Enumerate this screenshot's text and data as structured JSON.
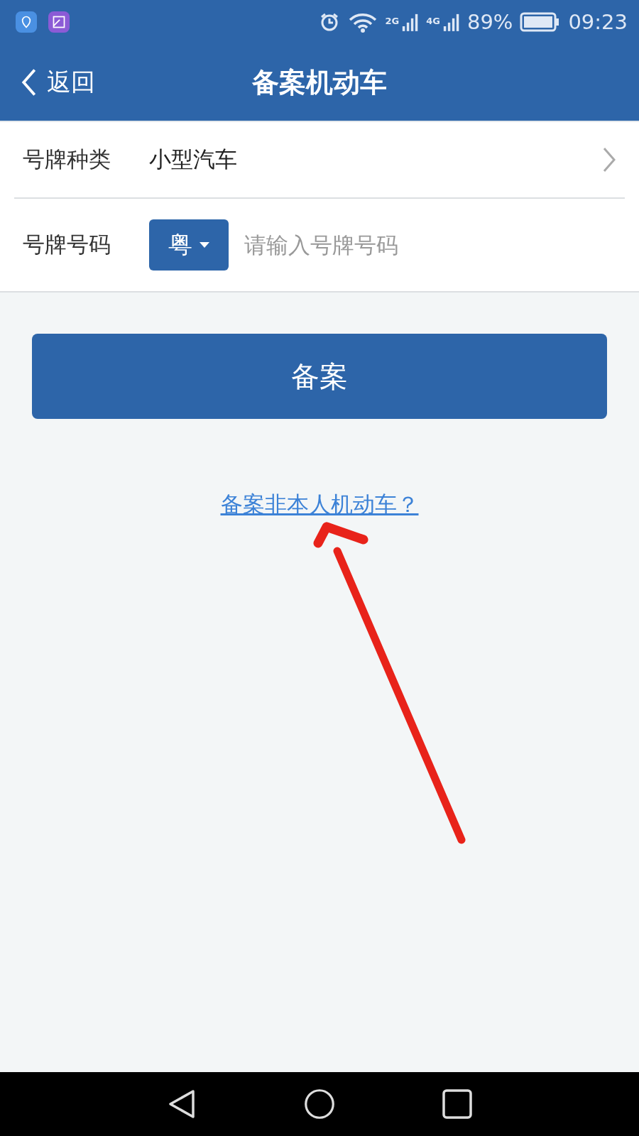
{
  "status_bar": {
    "network_1": "2G",
    "network_2": "4G",
    "battery": "89%",
    "time": "09:23"
  },
  "nav": {
    "back": "返回",
    "title": "备案机动车"
  },
  "form": [
    {
      "kind": "select",
      "label": "号牌种类",
      "value": "小型汽车"
    },
    {
      "kind": "plate",
      "label": "号牌号码",
      "prefix": "粤",
      "placeholder": "请输入号牌号码"
    }
  ],
  "submit": "备案",
  "link": "备案非本人机动车？"
}
